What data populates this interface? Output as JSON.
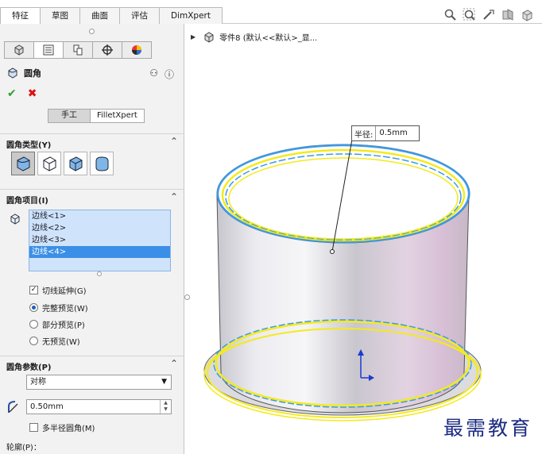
{
  "command_tabs": [
    "特征",
    "草图",
    "曲面",
    "评估",
    "DimXpert"
  ],
  "active_command_tab": "特征",
  "heads_up_toolbar": [
    "zoom-to-fit-icon",
    "zoom-to-area-icon",
    "previous-view-icon",
    "section-view-icon",
    "view-orientation-icon"
  ],
  "manager_tabs": [
    "featuremanager-icon",
    "propertymanager-icon",
    "configurationmanager-icon",
    "dimxpertmanager-icon",
    "displaymanager-icon"
  ],
  "property_manager": {
    "title": "圆角",
    "mode_tabs": [
      "手工",
      "FilletXpert"
    ],
    "active_mode": "手工",
    "sections": {
      "fillet_type": {
        "title": "圆角类型(Y)"
      },
      "fillet_items": {
        "title": "圆角项目(I)",
        "edges": [
          "边线<1>",
          "边线<2>",
          "边线<3>",
          "边线<4>"
        ],
        "selected_index": 3,
        "tangent_propagation": {
          "label": "切线延伸(G)",
          "checked": true
        },
        "preview_options": [
          {
            "label": "完整预览(W)",
            "selected": true
          },
          {
            "label": "部分预览(P)",
            "selected": false
          },
          {
            "label": "无预览(W)",
            "selected": false
          }
        ]
      },
      "fillet_params": {
        "title": "圆角参数(P)",
        "method": "对称",
        "radius_value": "0.50mm",
        "multi_radius": {
          "label": "多半径圆角(M)",
          "checked": false
        }
      },
      "profile": {
        "title": "轮廓(P)："
      }
    }
  },
  "viewport": {
    "tree_label": "零件8  (默认<<默认>_显...",
    "radius_callout": {
      "label": "半径:",
      "value": "0.5mm"
    },
    "watermark": "最需教育"
  },
  "colors": {
    "selection_yellow": "#f4ea1d",
    "highlight_blue": "#3b9ae8",
    "list_selected": "#3b8fe6",
    "accept_green": "#2da02d",
    "cancel_red": "#d11111"
  }
}
